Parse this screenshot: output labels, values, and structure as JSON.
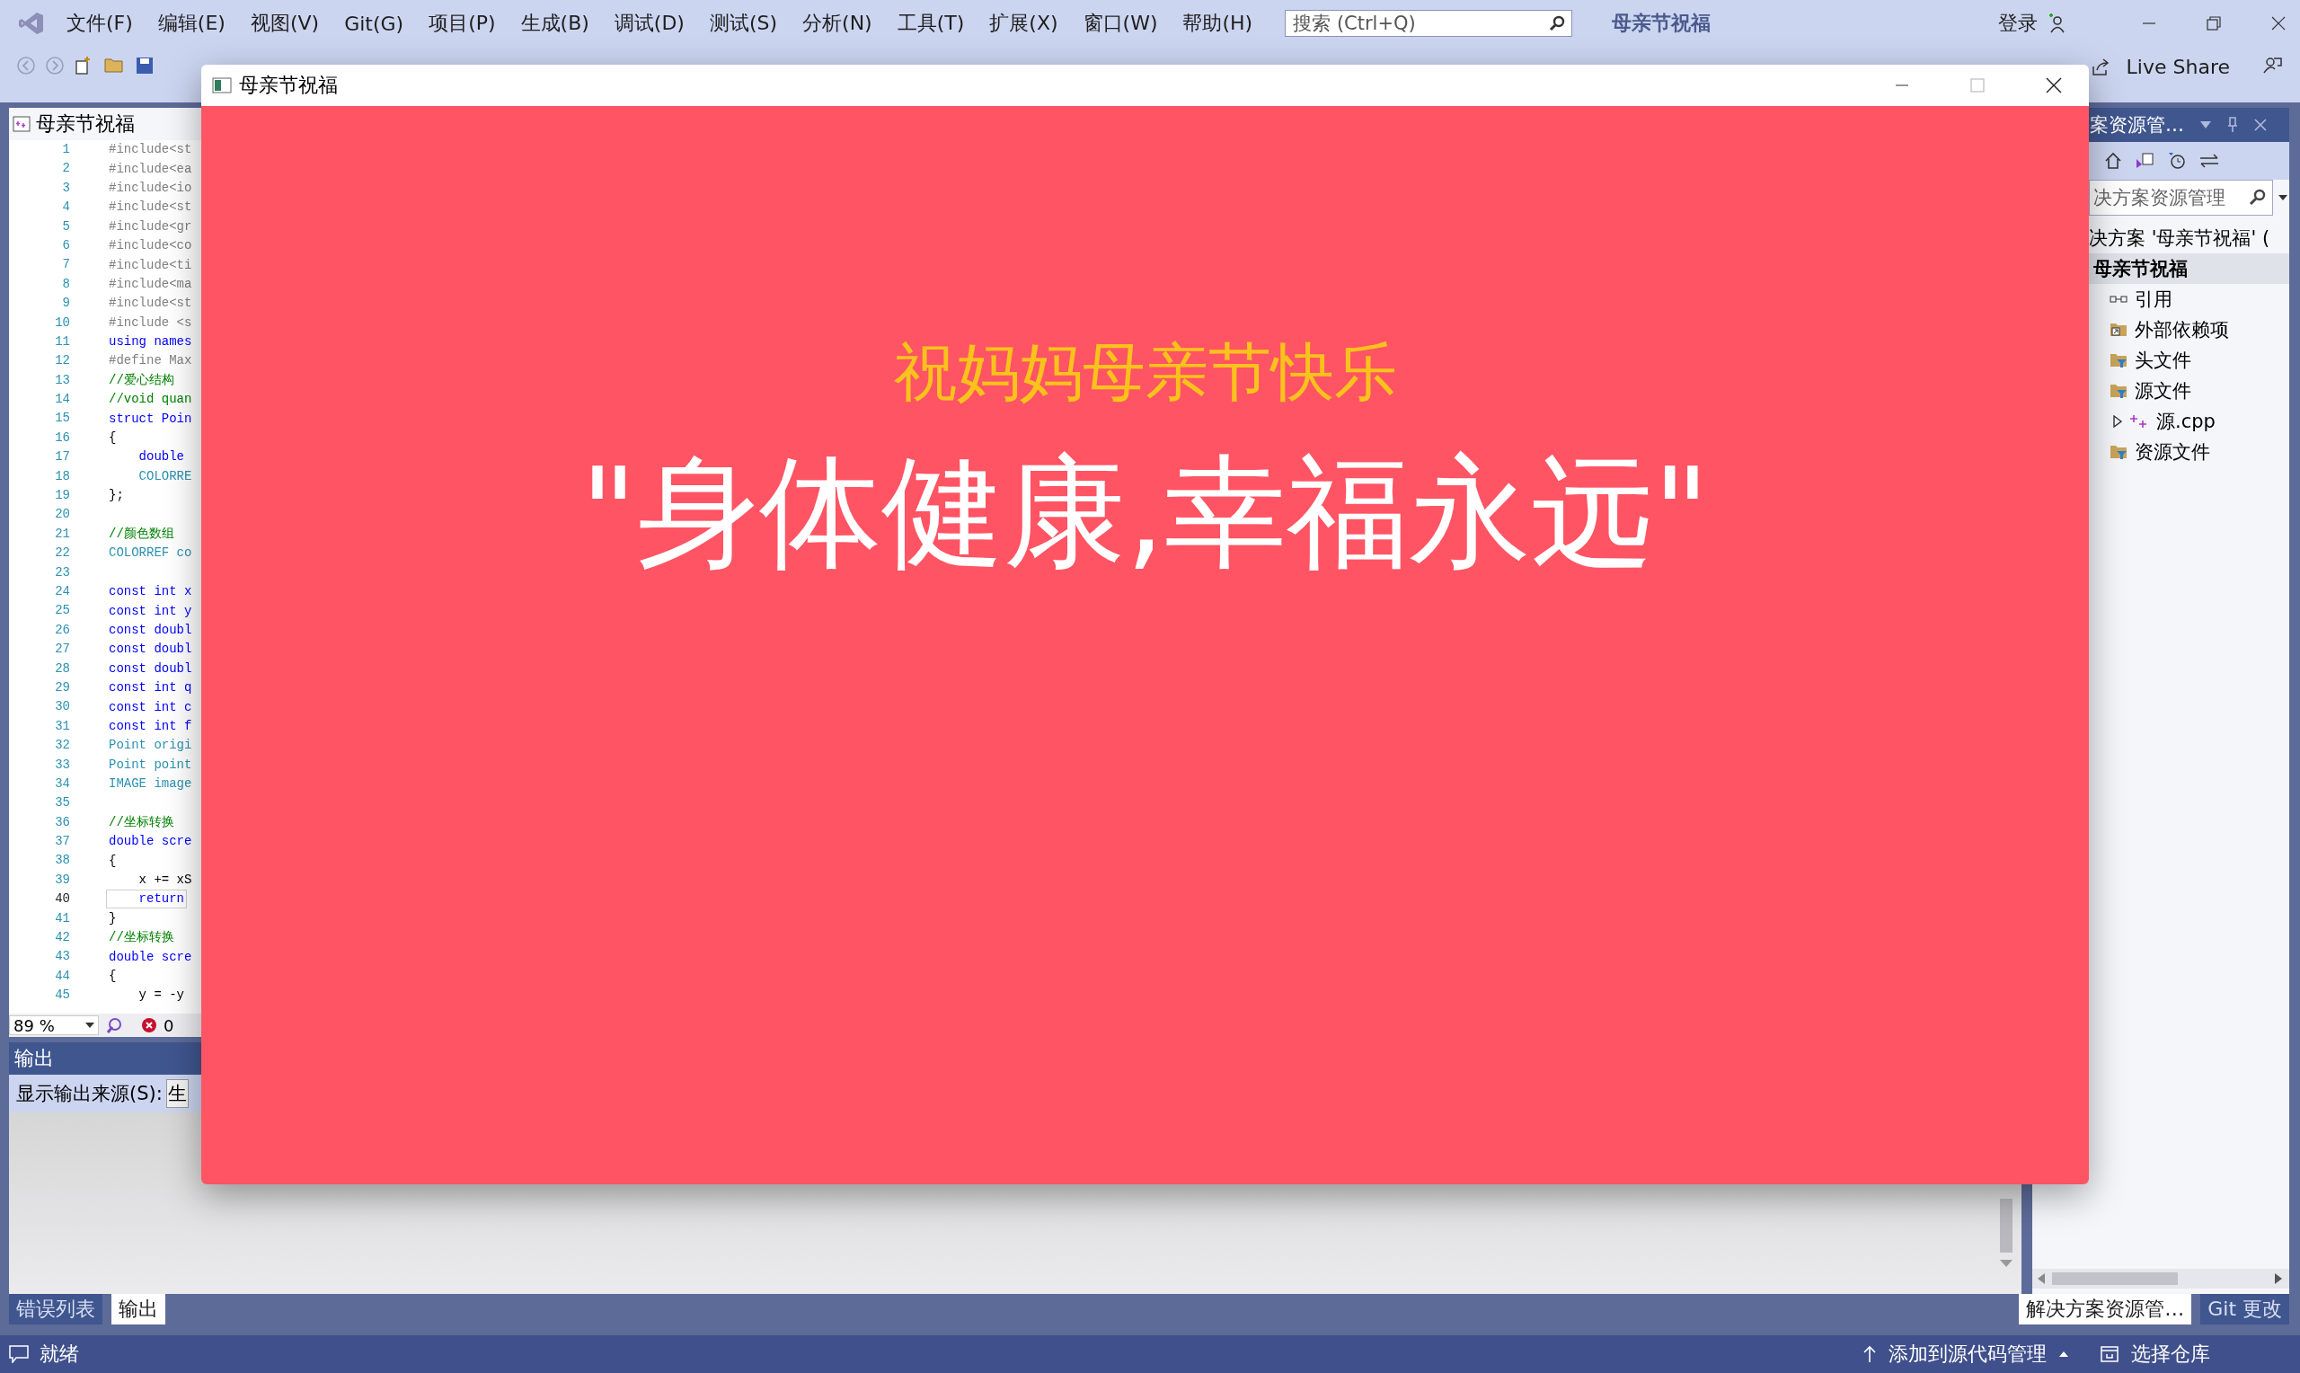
{
  "menu_bar": {
    "items": [
      "文件(F)",
      "编辑(E)",
      "视图(V)",
      "Git(G)",
      "项目(P)",
      "生成(B)",
      "调试(D)",
      "测试(S)",
      "分析(N)",
      "工具(T)",
      "扩展(X)",
      "窗口(W)",
      "帮助(H)"
    ],
    "search": {
      "placeholder": "搜索 (Ctrl+Q)"
    },
    "solution_name": "母亲节祝福",
    "sign_in": "登录"
  },
  "toolbar": {
    "live_share": "Live Share"
  },
  "editor": {
    "tab_title": "母亲节祝福",
    "lines": [
      {
        "number": "1",
        "text": "#include<st",
        "kind": "preprocessor",
        "current": false
      },
      {
        "number": "2",
        "text": "#include<ea",
        "kind": "preprocessor",
        "current": false
      },
      {
        "number": "3",
        "text": "#include<io",
        "kind": "preprocessor",
        "current": false
      },
      {
        "number": "4",
        "text": "#include<st",
        "kind": "preprocessor",
        "current": false
      },
      {
        "number": "5",
        "text": "#include<gr",
        "kind": "preprocessor",
        "current": false
      },
      {
        "number": "6",
        "text": "#include<co",
        "kind": "preprocessor",
        "current": false
      },
      {
        "number": "7",
        "text": "#include<ti",
        "kind": "preprocessor",
        "current": false
      },
      {
        "number": "8",
        "text": "#include<ma",
        "kind": "preprocessor",
        "current": false
      },
      {
        "number": "9",
        "text": "#include<st",
        "kind": "preprocessor",
        "current": false
      },
      {
        "number": "10",
        "text": "#include <s",
        "kind": "preprocessor",
        "current": false
      },
      {
        "number": "11",
        "text": "using names",
        "kind": "keyword",
        "current": false
      },
      {
        "number": "12",
        "text": "#define Max",
        "kind": "preprocessor",
        "current": false
      },
      {
        "number": "13",
        "text": "//爱心结构",
        "kind": "comment",
        "current": false
      },
      {
        "number": "14",
        "text": "//void quan",
        "kind": "comment",
        "current": false
      },
      {
        "number": "15",
        "text": "struct Poin",
        "kind": "keyword",
        "current": false
      },
      {
        "number": "16",
        "text": "{",
        "kind": "plain",
        "current": false
      },
      {
        "number": "17",
        "text": "    double",
        "kind": "keyword",
        "current": false
      },
      {
        "number": "18",
        "text": "    COLORRE",
        "kind": "type",
        "current": false
      },
      {
        "number": "19",
        "text": "};",
        "kind": "plain",
        "current": false
      },
      {
        "number": "20",
        "current": false
      },
      {
        "number": "21",
        "text": "//颜色数组",
        "kind": "comment",
        "current": false
      },
      {
        "number": "22",
        "text": "COLORREF co",
        "kind": "type",
        "current": false
      },
      {
        "number": "23",
        "current": false
      },
      {
        "number": "24",
        "text": "const int x",
        "kind": "keyword",
        "current": false
      },
      {
        "number": "25",
        "text": "const int y",
        "kind": "keyword",
        "current": false
      },
      {
        "number": "26",
        "text": "const doubl",
        "kind": "keyword",
        "current": false
      },
      {
        "number": "27",
        "text": "const doubl",
        "kind": "keyword",
        "current": false
      },
      {
        "number": "28",
        "text": "const doubl",
        "kind": "keyword",
        "current": false
      },
      {
        "number": "29",
        "text": "const int q",
        "kind": "keyword",
        "current": false
      },
      {
        "number": "30",
        "text": "const int c",
        "kind": "keyword",
        "current": false
      },
      {
        "number": "31",
        "text": "const int f",
        "kind": "keyword",
        "current": false
      },
      {
        "number": "32",
        "text": "Point origi",
        "kind": "type",
        "current": false
      },
      {
        "number": "33",
        "text": "Point point",
        "kind": "type",
        "current": false
      },
      {
        "number": "34",
        "text": "IMAGE image",
        "kind": "type",
        "current": false
      },
      {
        "number": "35",
        "current": false
      },
      {
        "number": "36",
        "text": "//坐标转换",
        "kind": "comment",
        "current": false
      },
      {
        "number": "37",
        "text": "double scre",
        "kind": "keyword",
        "current": false
      },
      {
        "number": "38",
        "text": "{",
        "kind": "plain",
        "current": false
      },
      {
        "number": "39",
        "text": "    x += xS",
        "kind": "plain",
        "current": false
      },
      {
        "number": "40",
        "text": "    return",
        "kind": "keyword",
        "current": true
      },
      {
        "number": "41",
        "text": "}",
        "kind": "plain",
        "current": false
      },
      {
        "number": "42",
        "text": "//坐标转换",
        "kind": "comment",
        "current": false
      },
      {
        "number": "43",
        "text": "double scre",
        "kind": "keyword",
        "current": false
      },
      {
        "number": "44",
        "text": "{",
        "kind": "plain",
        "current": false
      },
      {
        "number": "45",
        "text": "    y = -y",
        "kind": "plain",
        "current": false
      }
    ],
    "zoom": "89 %",
    "error_count": "0"
  },
  "output_panel": {
    "title": "输出",
    "source_label": "显示输出来源(S):",
    "source_value": "生"
  },
  "bottom_tabs": [
    {
      "label": "错误列表",
      "selected": false
    },
    {
      "label": "输出",
      "selected": true
    }
  ],
  "solution_explorer": {
    "title": "案资源管…",
    "search": {
      "placeholder": "决方案资源管理"
    },
    "solution": "决方案 '母亲节祝福' (",
    "project": {
      "label": "母亲节祝福",
      "selected": true,
      "children": [
        {
          "label": "引用",
          "kind": "references"
        },
        {
          "label": "外部依赖项",
          "kind": "external"
        },
        {
          "label": "头文件",
          "kind": "filter"
        },
        {
          "label": "源文件",
          "kind": "filter",
          "children": [
            {
              "label": "源.cpp",
              "kind": "cpp",
              "expanded": false
            }
          ]
        },
        {
          "label": "资源文件",
          "kind": "filter"
        }
      ]
    }
  },
  "side_tabs": [
    {
      "label": "解决方案资源管…",
      "selected": true
    },
    {
      "label": "Git 更改",
      "selected": false
    }
  ],
  "status_bar": {
    "status": "就绪",
    "source_control": "添加到源代码管理",
    "repository": "选择仓库"
  },
  "app_window": {
    "title": "母亲节祝福",
    "greeting": "祝妈妈母亲节快乐",
    "wish": "\"身体健康,幸福永远\""
  }
}
